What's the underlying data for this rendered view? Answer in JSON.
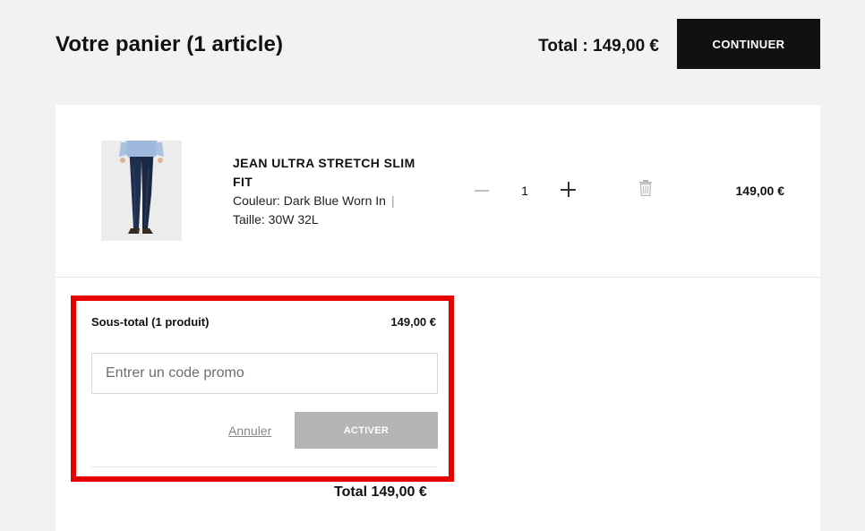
{
  "header": {
    "title": "Votre panier (1 article)",
    "total": "Total : 149,00 €",
    "continue_label": "CONTINUER"
  },
  "cart_item": {
    "name": "JEAN ULTRA STRETCH SLIM FIT",
    "color": "Couleur: Dark Blue Worn In",
    "separator": "|",
    "size": "Taille: 30W 32L",
    "quantity": "1",
    "price": "149,00 €",
    "icons": [
      "minus-icon",
      "plus-icon",
      "trash-icon"
    ]
  },
  "summary": {
    "subtotal_label": "Sous-total (1 produit)",
    "subtotal_value": "149,00 €",
    "promo_placeholder": "Entrer un code promo",
    "promo_value": "",
    "cancel_label": "Annuler",
    "activate_label": "ACTIVER",
    "total": "Total 149,00 €"
  },
  "colors": {
    "background": "#f2f2f2",
    "primary_button": "#111111",
    "disabled_button": "#b4b4b4",
    "highlight": "#e60000"
  }
}
